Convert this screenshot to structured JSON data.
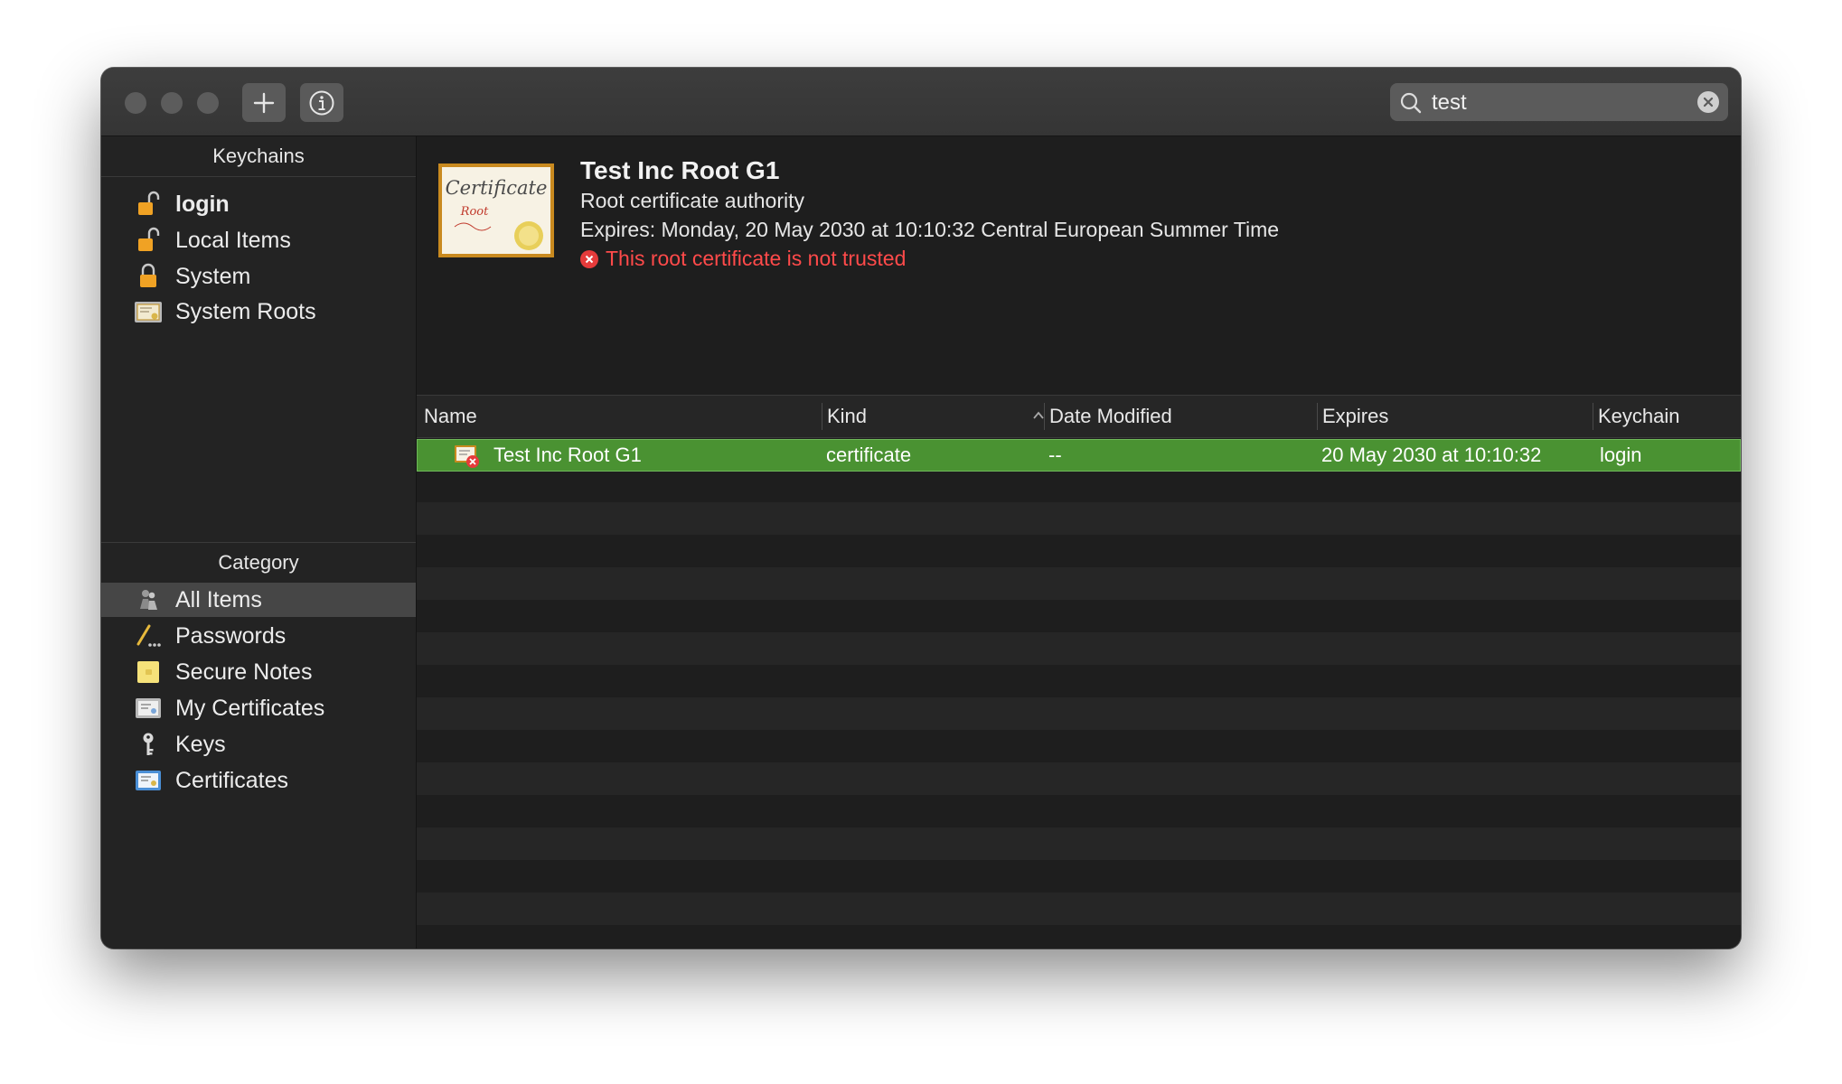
{
  "toolbar": {
    "add_icon": "plus-icon",
    "info_icon": "info-icon"
  },
  "search": {
    "value": "test",
    "search_icon": "magnifier-icon",
    "clear_icon": "clear-icon"
  },
  "sidebar": {
    "keychains_header": "Keychains",
    "keychains": [
      {
        "label": "login",
        "icon": "unlocked-padlock-icon",
        "bold": true
      },
      {
        "label": "Local Items",
        "icon": "unlocked-padlock-icon"
      },
      {
        "label": "System",
        "icon": "locked-padlock-icon"
      },
      {
        "label": "System Roots",
        "icon": "certificate-folder-icon"
      }
    ],
    "category_header": "Category",
    "categories": [
      {
        "label": "All Items",
        "icon": "people-icon",
        "selected": true
      },
      {
        "label": "Passwords",
        "icon": "pencil-dots-icon"
      },
      {
        "label": "Secure Notes",
        "icon": "note-icon"
      },
      {
        "label": "My Certificates",
        "icon": "my-certificate-icon"
      },
      {
        "label": "Keys",
        "icon": "key-icon"
      },
      {
        "label": "Certificates",
        "icon": "certificate-icon"
      }
    ]
  },
  "detail": {
    "title": "Test Inc Root G1",
    "subtitle": "Root certificate authority",
    "expires": "Expires: Monday, 20 May 2030 at 10:10:32 Central European Summer Time",
    "warning": "This root certificate is not trusted",
    "cert_image_text_1": "Certificate",
    "cert_image_text_2": "Root"
  },
  "table": {
    "columns": [
      "Name",
      "Kind",
      "Date Modified",
      "Expires",
      "Keychain"
    ],
    "rows": [
      {
        "name": "Test Inc Root G1",
        "kind": "certificate",
        "date_modified": "--",
        "expires": "20 May 2030 at 10:10:32",
        "keychain": "login"
      }
    ]
  },
  "colors": {
    "selection": "#4a9232",
    "warning": "#ff4a4a",
    "background": "#1e1e1e"
  }
}
